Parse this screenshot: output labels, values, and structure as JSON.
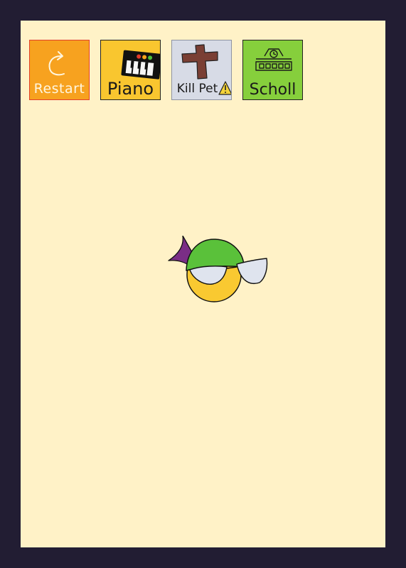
{
  "toolbar": {
    "restart_label": "Restart",
    "piano_label": "Piano",
    "kill_pet_label": "Kill Pet",
    "school_label": "Scholl"
  },
  "colors": {
    "outer_background": "#221d33",
    "play_area": "#fff2c7",
    "restart_button": "#f7a21f",
    "piano_button": "#f9c62f",
    "kill_pet_button": "#d7dbe6",
    "school_button": "#86cf3c",
    "pet_body": "#f9c931",
    "pet_hat": "#5ac13a",
    "pet_feather": "#7a2e86",
    "pet_glasses": "#dfe4ee"
  },
  "icons": [
    "restart-arrow-icon",
    "piano-keyboard-icon",
    "cross-icon",
    "warning-icon",
    "school-building-icon"
  ]
}
